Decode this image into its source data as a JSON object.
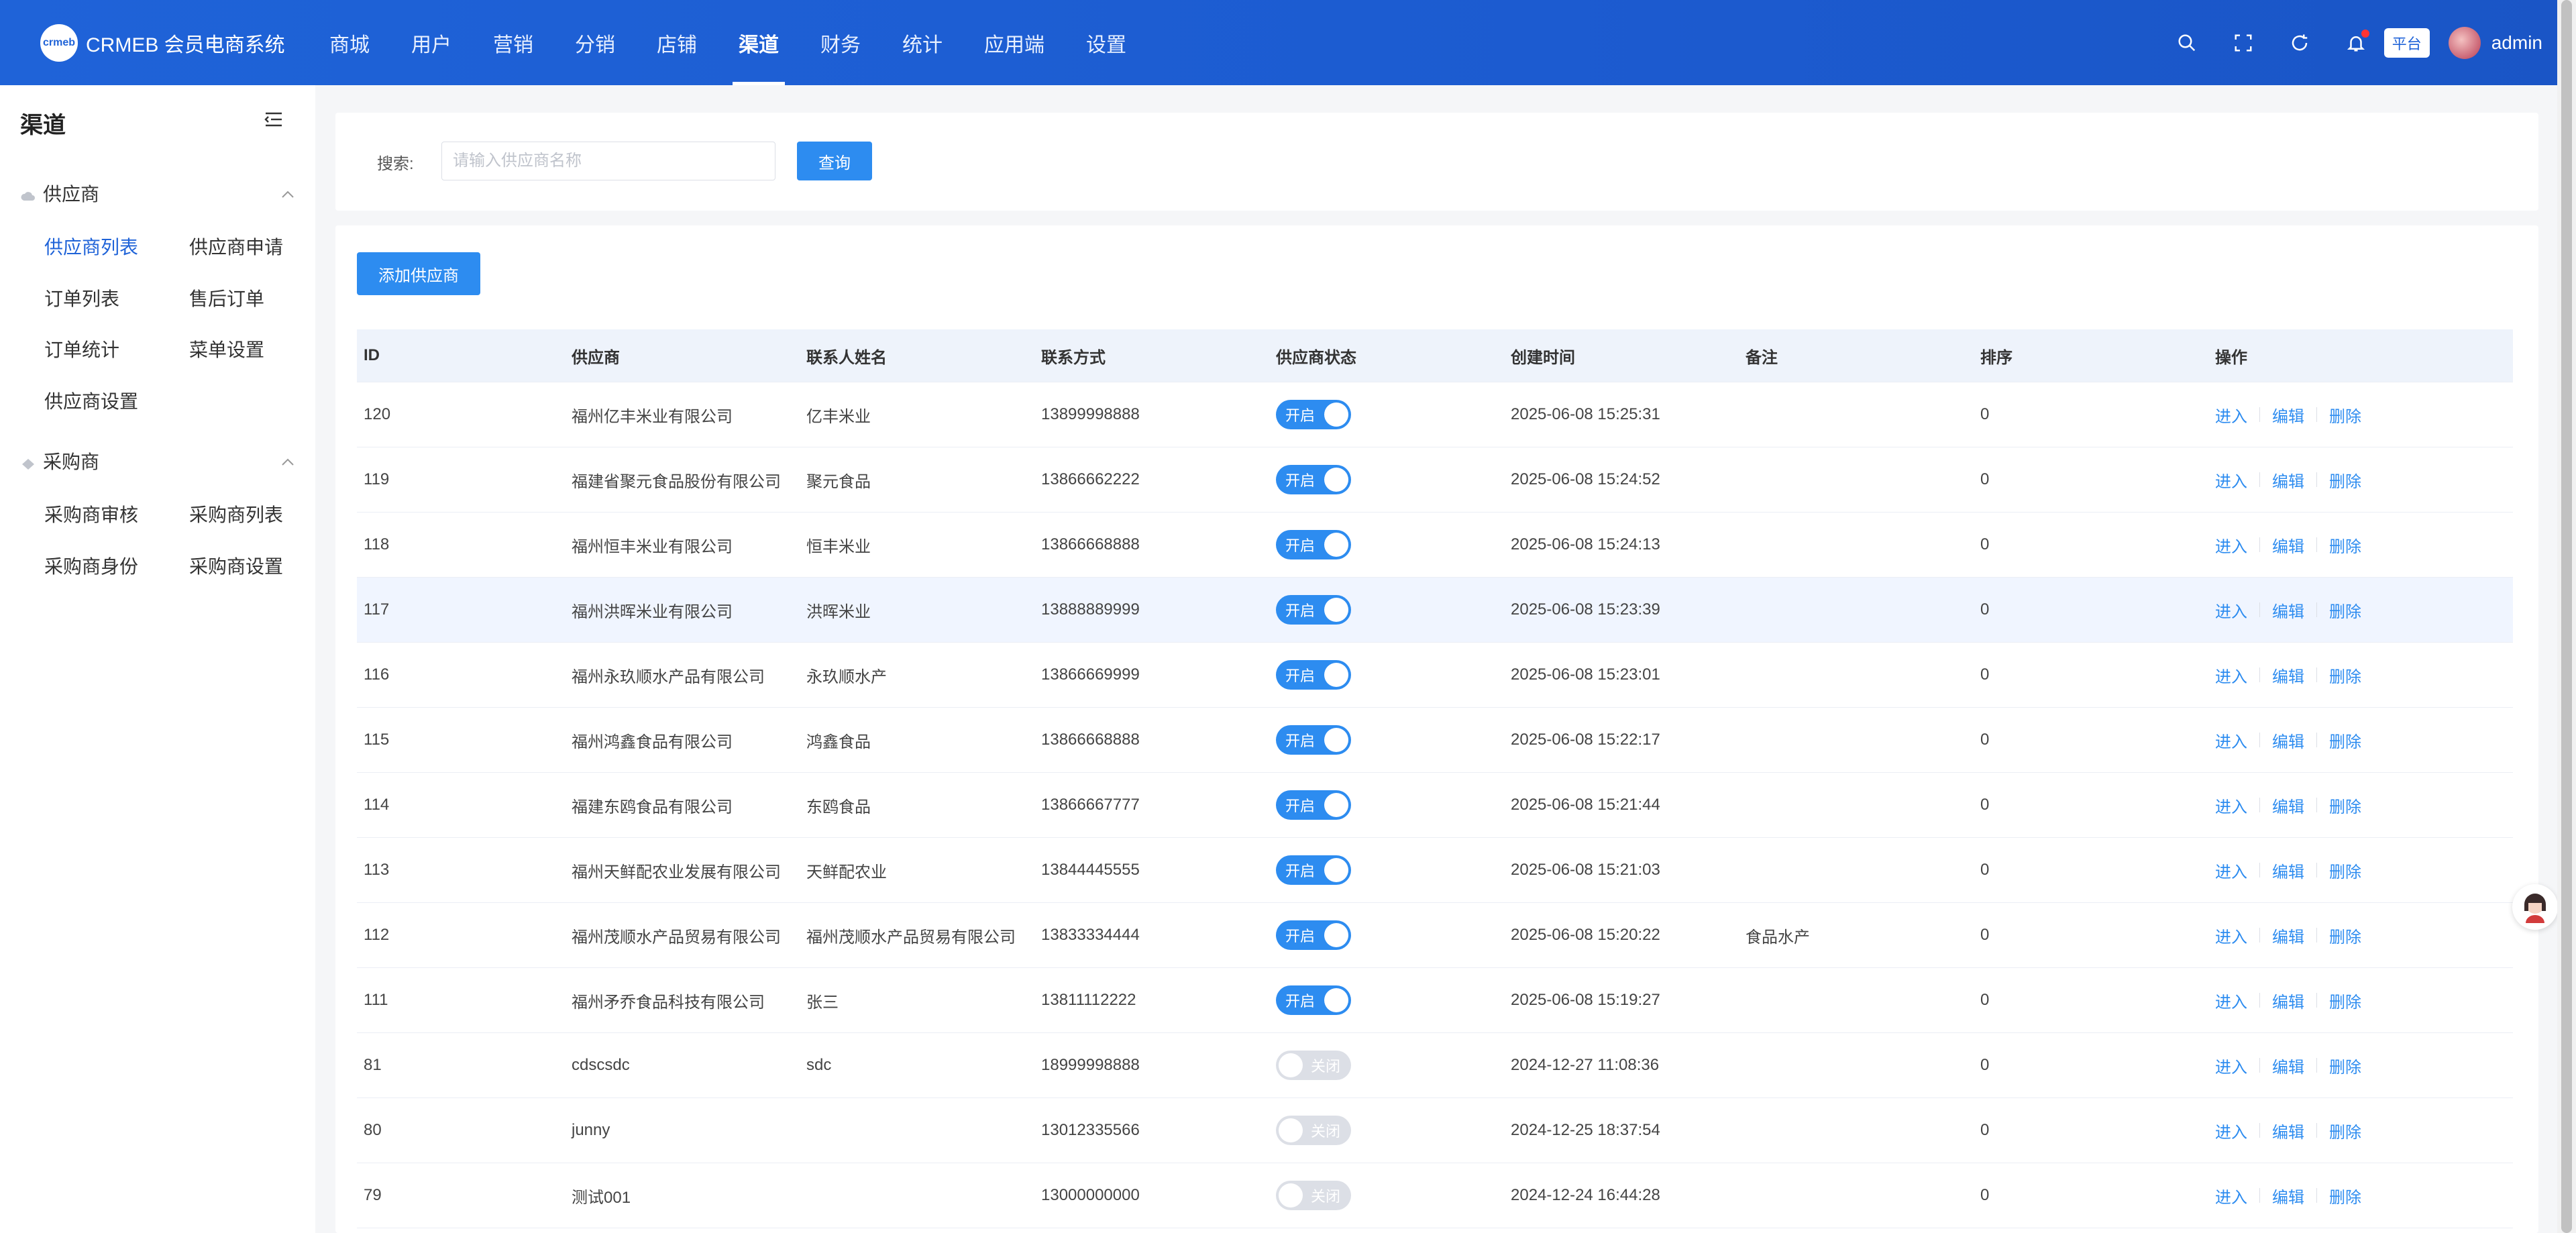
{
  "header": {
    "logo_text": "CRMEB 会员电商系统",
    "logo_mark": "crmeb",
    "nav": [
      "商城",
      "用户",
      "营销",
      "分销",
      "店铺",
      "渠道",
      "财务",
      "统计",
      "应用端",
      "设置"
    ],
    "active_nav": "渠道",
    "platform_label": "平台",
    "admin_name": "admin",
    "icons": [
      "search-icon",
      "fullscreen-icon",
      "refresh-icon",
      "bell-icon"
    ]
  },
  "sidebar": {
    "title": "渠道",
    "groups": [
      {
        "label": "供应商",
        "items": [
          "供应商列表",
          "供应商申请",
          "订单列表",
          "售后订单",
          "订单统计",
          "菜单设置",
          "供应商设置"
        ]
      },
      {
        "label": "采购商",
        "items": [
          "采购商审核",
          "采购商列表",
          "采购商身份",
          "采购商设置"
        ]
      }
    ],
    "active_item": "供应商列表"
  },
  "search": {
    "label": "搜索:",
    "placeholder": "请输入供应商名称",
    "value": "",
    "button": "查询"
  },
  "table": {
    "add_button": "添加供应商",
    "columns": [
      "ID",
      "供应商",
      "联系人姓名",
      "联系方式",
      "供应商状态",
      "创建时间",
      "备注",
      "排序",
      "操作"
    ],
    "status_on": "开启",
    "status_off": "关闭",
    "actions": [
      "进入",
      "编辑",
      "删除"
    ],
    "rows": [
      {
        "id": "120",
        "supplier": "福州亿丰米业有限公司",
        "contact": "亿丰米业",
        "phone": "13899998888",
        "status": true,
        "created": "2025-06-08 15:25:31",
        "note": "",
        "sort": "0"
      },
      {
        "id": "119",
        "supplier": "福建省聚元食品股份有限公司",
        "contact": "聚元食品",
        "phone": "13866662222",
        "status": true,
        "created": "2025-06-08 15:24:52",
        "note": "",
        "sort": "0"
      },
      {
        "id": "118",
        "supplier": "福州恒丰米业有限公司",
        "contact": "恒丰米业",
        "phone": "13866668888",
        "status": true,
        "created": "2025-06-08 15:24:13",
        "note": "",
        "sort": "0"
      },
      {
        "id": "117",
        "supplier": "福州洪晖米业有限公司",
        "contact": "洪晖米业",
        "phone": "13888889999",
        "status": true,
        "created": "2025-06-08 15:23:39",
        "note": "",
        "sort": "0"
      },
      {
        "id": "116",
        "supplier": "福州永玖顺水产品有限公司",
        "contact": "永玖顺水产",
        "phone": "13866669999",
        "status": true,
        "created": "2025-06-08 15:23:01",
        "note": "",
        "sort": "0"
      },
      {
        "id": "115",
        "supplier": "福州鸿鑫食品有限公司",
        "contact": "鸿鑫食品",
        "phone": "13866668888",
        "status": true,
        "created": "2025-06-08 15:22:17",
        "note": "",
        "sort": "0"
      },
      {
        "id": "114",
        "supplier": "福建东鸥食品有限公司",
        "contact": "东鸥食品",
        "phone": "13866667777",
        "status": true,
        "created": "2025-06-08 15:21:44",
        "note": "",
        "sort": "0"
      },
      {
        "id": "113",
        "supplier": "福州天鲜配农业发展有限公司",
        "contact": "天鲜配农业",
        "phone": "13844445555",
        "status": true,
        "created": "2025-06-08 15:21:03",
        "note": "",
        "sort": "0"
      },
      {
        "id": "112",
        "supplier": "福州茂顺水产品贸易有限公司",
        "contact": "福州茂顺水产品贸易有限公司",
        "phone": "13833334444",
        "status": true,
        "created": "2025-06-08 15:20:22",
        "note": "食品水产",
        "sort": "0"
      },
      {
        "id": "111",
        "supplier": "福州矛乔食品科技有限公司",
        "contact": "张三",
        "phone": "13811112222",
        "status": true,
        "created": "2025-06-08 15:19:27",
        "note": "",
        "sort": "0"
      },
      {
        "id": "81",
        "supplier": "cdscsdc",
        "contact": "sdc",
        "phone": "18999998888",
        "status": false,
        "created": "2024-12-27 11:08:36",
        "note": "",
        "sort": "0"
      },
      {
        "id": "80",
        "supplier": "junny",
        "contact": "",
        "phone": "13012335566",
        "status": false,
        "created": "2024-12-25 18:37:54",
        "note": "",
        "sort": "0"
      },
      {
        "id": "79",
        "supplier": "测试001",
        "contact": "",
        "phone": "13000000000",
        "status": false,
        "created": "2024-12-24 16:44:28",
        "note": "",
        "sort": "0"
      }
    ]
  },
  "colors": {
    "header_bg": "#1f63d8",
    "primary": "#2d8cf0",
    "toggle_off": "#dcdfe6"
  }
}
